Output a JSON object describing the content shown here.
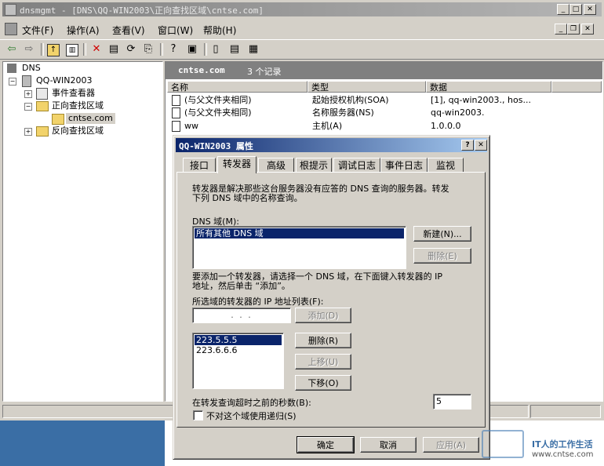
{
  "window": {
    "title": "dnsmgmt - [DNS\\QQ-WIN2003\\正向查找区域\\cntse.com]"
  },
  "menu": [
    "文件(F)",
    "操作(A)",
    "查看(V)",
    "窗口(W)",
    "帮助(H)"
  ],
  "tree": {
    "root": "DNS",
    "server": "QQ-WIN2003",
    "event_viewer": "事件查看器",
    "forward_zones": "正向查找区域",
    "zone": "cntse.com",
    "reverse_zones": "反向查找区域"
  },
  "list": {
    "zone_name": "cntse.com",
    "record_count": "3 个记录",
    "columns": [
      "名称",
      "类型",
      "数据"
    ],
    "rows": [
      {
        "name": "(与父文件夹相同)",
        "type": "起始授权机构(SOA)",
        "data": "[1], qq-win2003., hos..."
      },
      {
        "name": "(与父文件夹相同)",
        "type": "名称服务器(NS)",
        "data": "qq-win2003."
      },
      {
        "name": "ww",
        "type": "主机(A)",
        "data": "1.0.0.0"
      }
    ]
  },
  "dialog": {
    "title": "QQ-WIN2003 属性",
    "tabs": [
      "接口",
      "转发器",
      "高级",
      "根提示",
      "调试日志",
      "事件日志",
      "监视"
    ],
    "description": [
      "转发器是解决那些这台服务器没有应答的 DNS 查询的服务器。转发",
      "下列 DNS 域中的名称查询。"
    ],
    "dns_domain_label": "DNS 域(M):",
    "dns_domains": [
      "所有其他 DNS 域"
    ],
    "new_button": "新建(N)...",
    "delete_domain_button": "删除(E)",
    "add_instruction": [
      "要添加一个转发器，请选择一个 DNS 域，在下面键入转发器的 IP",
      "地址，然后单击 “添加”。"
    ],
    "ip_list_label": "所选域的转发器的 IP 地址列表(F):",
    "ip_input_placeholder": ".     .     .",
    "add_button": "添加(D)",
    "forwarder_ips": [
      "223.5.5.5",
      "223.6.6.6"
    ],
    "remove_button": "删除(R)",
    "move_up_button": "上移(U)",
    "move_down_button": "下移(O)",
    "timeout_label": "在转发查询超时之前的秒数(B):",
    "timeout_value": "5",
    "no_recursion_label": "不对这个域使用递归(S)",
    "ok_button": "确定",
    "cancel_button": "取消",
    "apply_button": "应用(A)"
  },
  "watermark": {
    "title": "IT人的工作生活",
    "url": "www.cntse.com"
  }
}
